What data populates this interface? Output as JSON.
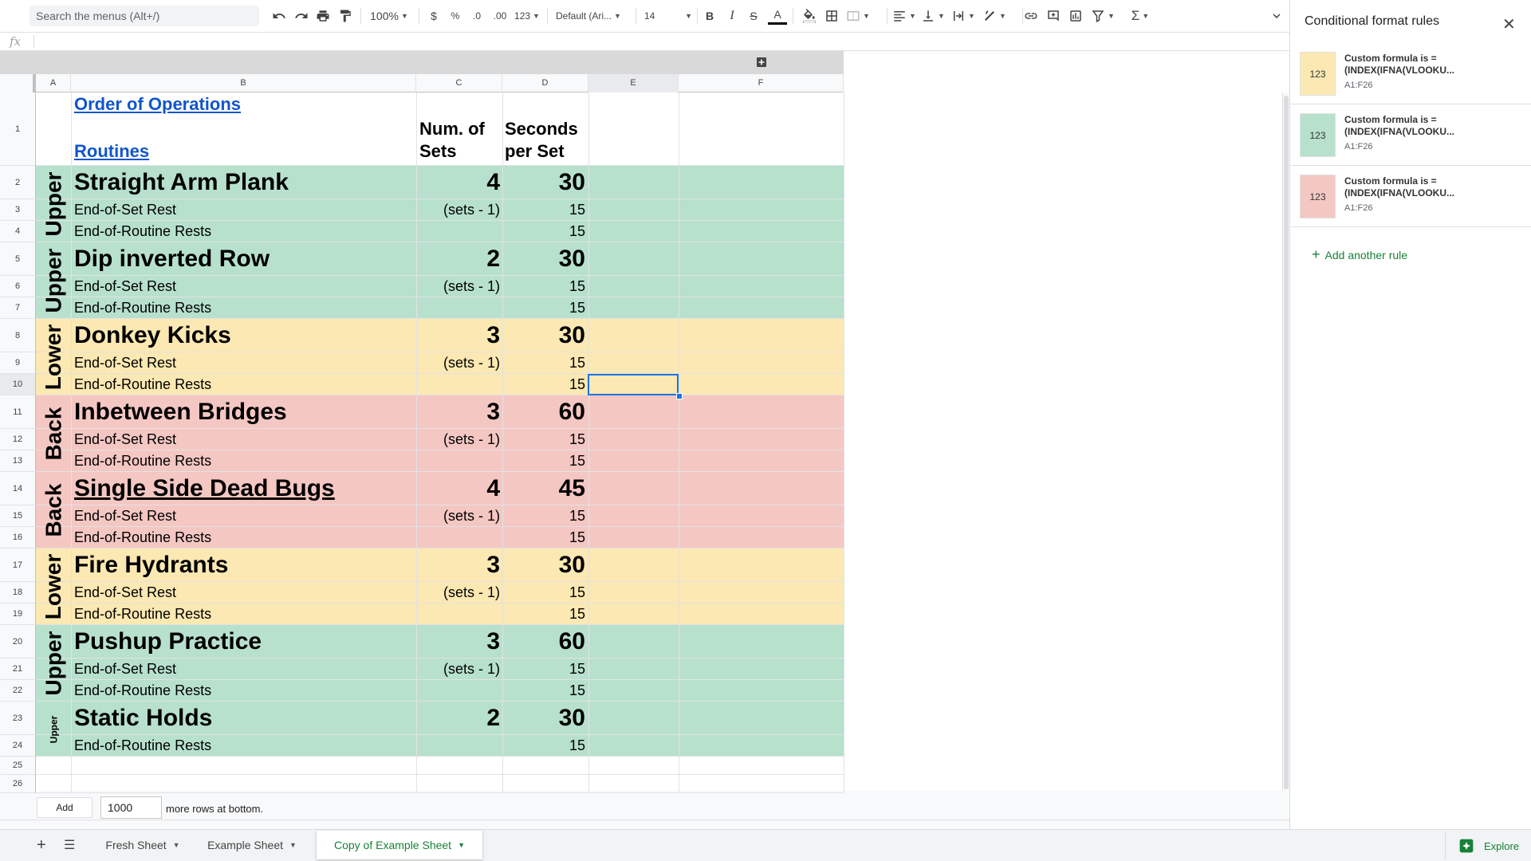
{
  "toolbar": {
    "search_placeholder": "Search the menus (Alt+/)",
    "zoom": "100%",
    "currency": "$",
    "percent": "%",
    "decrease_decimal": ".0",
    "increase_decimal": ".00",
    "more_formats": "123",
    "font_family": "Default (Ari...",
    "font_size": "14"
  },
  "formula_bar": {
    "fx_label": "fx"
  },
  "columns": [
    "A",
    "B",
    "C",
    "D",
    "E",
    "F"
  ],
  "rows": [
    "1",
    "2",
    "3",
    "4",
    "5",
    "6",
    "7",
    "8",
    "9",
    "10",
    "11",
    "12",
    "13",
    "14",
    "15",
    "16",
    "17",
    "18",
    "19",
    "20",
    "21",
    "22",
    "23",
    "24",
    "25",
    "26"
  ],
  "header": {
    "order_link": "Order of Operations",
    "routines_link": "Routines",
    "num_sets_line1": "Num. of",
    "num_sets_line2": "Sets",
    "seconds_line1": "Seconds",
    "seconds_line2": "per Set"
  },
  "routines": [
    {
      "label": "Upper",
      "name": "Straight Arm Plank",
      "sets": "4",
      "seconds": "30",
      "color": "#b7e1cd"
    },
    {
      "label": "Upper",
      "name": "Dip inverted Row",
      "sets": "2",
      "seconds": "30",
      "color": "#b7e1cd"
    },
    {
      "label": "Lower",
      "name": "Donkey Kicks",
      "sets": "3",
      "seconds": "30",
      "color": "#fce8b2"
    },
    {
      "label": "Back",
      "name": "Inbetween Bridges",
      "sets": "3",
      "seconds": "60",
      "color": "#f4c7c3"
    },
    {
      "label": "Back",
      "name": "Single Side Dead Bugs",
      "sets": "4",
      "seconds": "45",
      "color": "#f4c7c3"
    },
    {
      "label": "Lower",
      "name": "Fire Hydrants",
      "sets": "3",
      "seconds": "30",
      "color": "#fce8b2"
    },
    {
      "label": "Upper",
      "name": "Pushup Practice",
      "sets": "3",
      "seconds": "60",
      "color": "#b7e1cd"
    },
    {
      "label": "Upper",
      "name": "Static Holds",
      "sets": "2",
      "seconds": "30",
      "color": "#b7e1cd"
    }
  ],
  "sub_rows": {
    "set_rest_label": "End-of-Set Rest",
    "set_rest_sets": "(sets - 1)",
    "set_rest_seconds": "15",
    "routine_rest_label": "End-of-Routine Rests",
    "routine_rest_seconds": "15"
  },
  "add_rows": {
    "button": "Add",
    "count": "1000",
    "label": "more rows at bottom."
  },
  "sheet_tabs": [
    "Fresh Sheet",
    "Example Sheet",
    "Copy of Example Sheet"
  ],
  "explore_label": "Explore",
  "side_panel": {
    "title": "Conditional format rules",
    "rules": [
      {
        "preview": "123",
        "line1": "Custom formula is =",
        "line2": "(INDEX(IFNA(VLOOKU...",
        "range": "A1:F26",
        "color": "#fce8b2"
      },
      {
        "preview": "123",
        "line1": "Custom formula is =",
        "line2": "(INDEX(IFNA(VLOOKU...",
        "range": "A1:F26",
        "color": "#b7e1cd"
      },
      {
        "preview": "123",
        "line1": "Custom formula is =",
        "line2": "(INDEX(IFNA(VLOOKU...",
        "range": "A1:F26",
        "color": "#f4c7c3"
      }
    ],
    "add_rule": "Add another rule"
  }
}
